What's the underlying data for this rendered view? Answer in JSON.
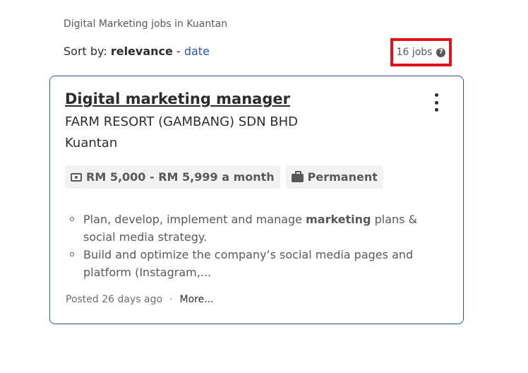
{
  "breadcrumb": "Digital Marketing jobs in Kuantan",
  "sort": {
    "label": "Sort by:",
    "active": "relevance",
    "separator": "-",
    "other": "date"
  },
  "job_count": "16 jobs",
  "help_icon": "?",
  "job": {
    "title": "Digital marketing manager",
    "company": "FARM RESORT (GAMBANG) SDN BHD",
    "location": "Kuantan",
    "salary": "RM 5,000 - RM 5,999 a month",
    "job_type": "Permanent",
    "snippet": [
      {
        "before": "Plan, develop, implement and manage ",
        "bold": "marketing",
        "after": " plans & social media strategy."
      },
      {
        "before": "Build and optimize the company’s social media pages and platform (Instagram,...",
        "bold": "",
        "after": ""
      }
    ],
    "posted": "Posted 26 days ago",
    "dot": "·",
    "more": "More..."
  },
  "colors": {
    "link": "#2557a7",
    "highlight_border": "#e0131b",
    "card_border": "#2557a7"
  }
}
